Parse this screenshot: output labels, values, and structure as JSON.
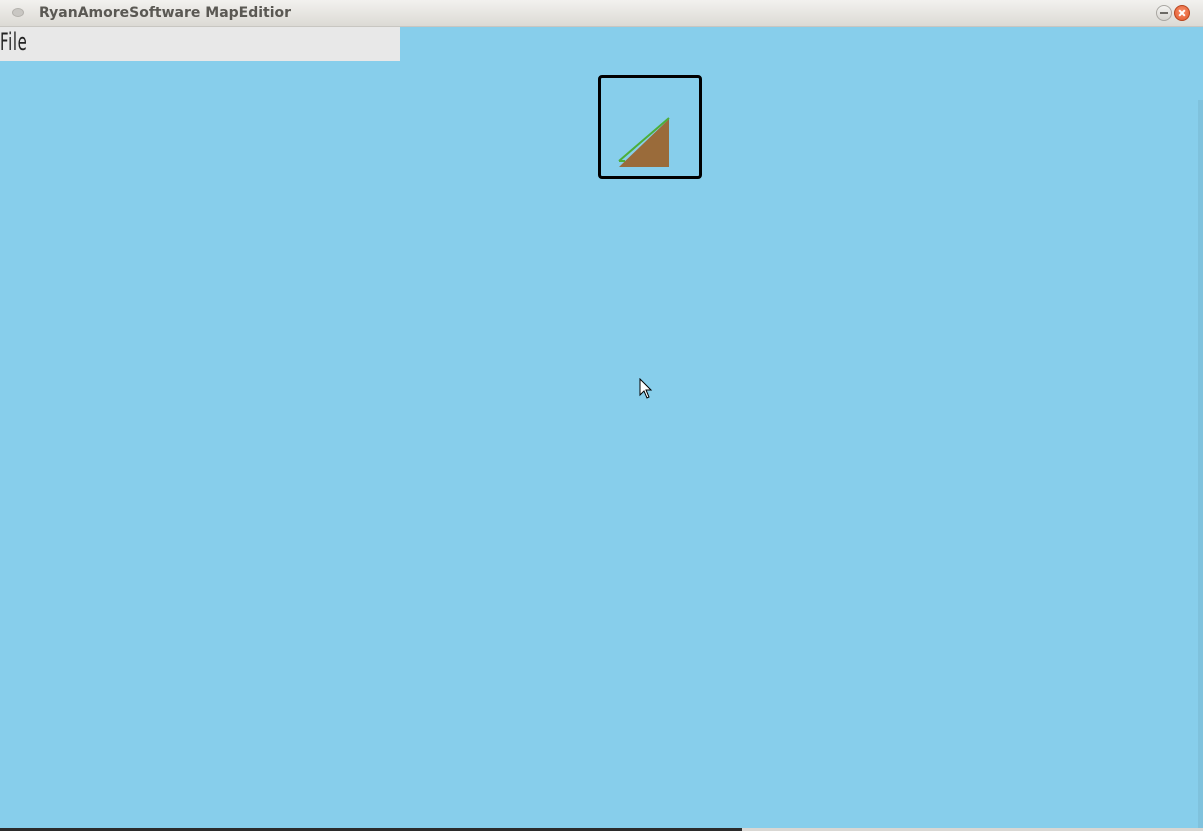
{
  "window": {
    "title": "RyanAmoreSoftware MapEditior",
    "background_color": "#87ceeb"
  },
  "menubar": {
    "file_label": "File"
  },
  "tile_preview": {
    "icon": "grass-slope-tile-icon",
    "dirt_color": "#9a6b3a",
    "grass_color": "#4caf3a"
  },
  "icons": {
    "window_menu": "window-menu-icon",
    "minimize": "minimize-icon",
    "close": "close-icon",
    "cursor": "mouse-pointer-icon"
  }
}
